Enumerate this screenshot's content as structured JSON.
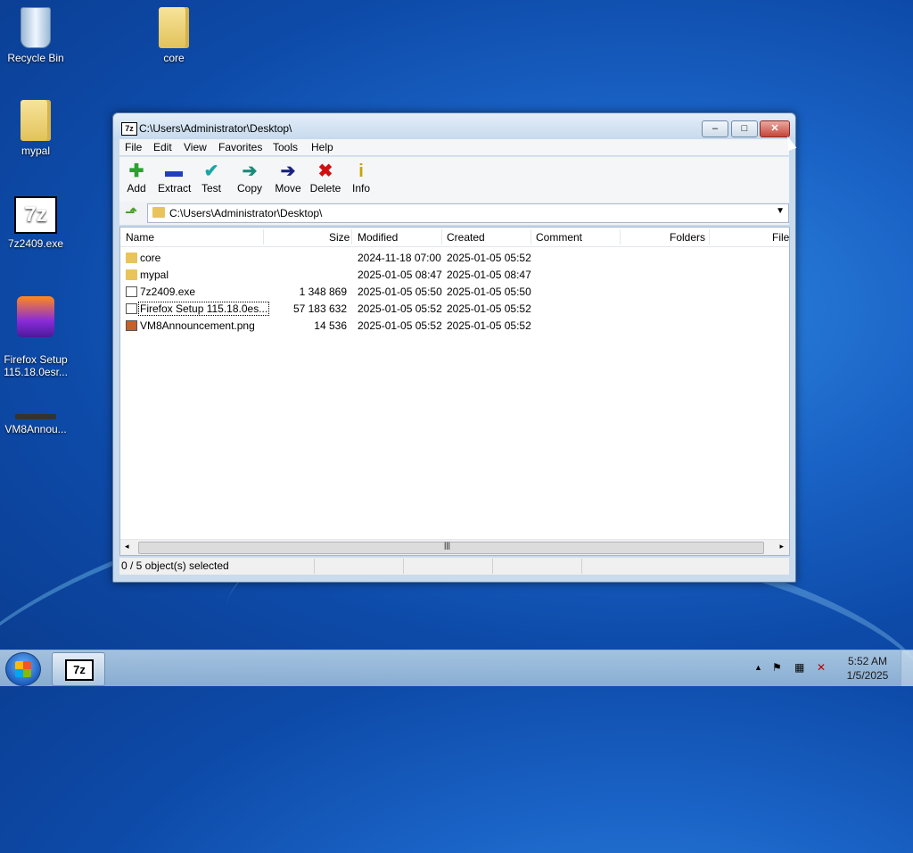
{
  "desktop": {
    "icons": [
      {
        "label": "Recycle Bin",
        "icon": "recycle-bin-icon"
      },
      {
        "label": "core",
        "icon": "folder-icon"
      },
      {
        "label": "mypal",
        "icon": "folder-icon"
      },
      {
        "label": "7z2409.exe",
        "icon": "7zip-icon"
      },
      {
        "label": "Firefox Setup\n115.18.0esr...",
        "icon": "firefox-icon"
      },
      {
        "label": "VM8Annou...",
        "icon": "image-file-icon"
      }
    ]
  },
  "window": {
    "title": "C:\\Users\\Administrator\\Desktop\\",
    "app_icon_text": "7z",
    "controls": {
      "minimize": "–",
      "maximize": "□",
      "close": "✕"
    }
  },
  "menu": [
    "File",
    "Edit",
    "View",
    "Favorites",
    "Tools",
    "Help"
  ],
  "toolbar": [
    {
      "label": "Add",
      "glyph": "✚",
      "color": "#2aa32a"
    },
    {
      "label": "Extract",
      "glyph": "▬",
      "color": "#1f3fbf"
    },
    {
      "label": "Test",
      "glyph": "✔",
      "color": "#1aa6a6"
    },
    {
      "label": "Copy",
      "glyph": "➔",
      "color": "#1c8a7a"
    },
    {
      "label": "Move",
      "glyph": "➔",
      "color": "#1a237e"
    },
    {
      "label": "Delete",
      "glyph": "✖",
      "color": "#d01010"
    },
    {
      "label": "Info",
      "glyph": "i",
      "color": "#c9a400"
    }
  ],
  "address": {
    "path": "C:\\Users\\Administrator\\Desktop\\"
  },
  "columns": [
    "Name",
    "Size",
    "Modified",
    "Created",
    "Comment",
    "Folders",
    "File"
  ],
  "files": [
    {
      "name": "core",
      "size": "",
      "modified": "2024-11-18 07:00",
      "created": "2025-01-05 05:52",
      "type": "folder"
    },
    {
      "name": "mypal",
      "size": "",
      "modified": "2025-01-05 08:47",
      "created": "2025-01-05 08:47",
      "type": "folder"
    },
    {
      "name": "7z2409.exe",
      "size": "1 348 869",
      "modified": "2025-01-05 05:50",
      "created": "2025-01-05 05:50",
      "type": "exe"
    },
    {
      "name": "Firefox Setup 115.18.0es...",
      "size": "57 183 632",
      "modified": "2025-01-05 05:52",
      "created": "2025-01-05 05:52",
      "type": "exe"
    },
    {
      "name": "VM8Announcement.png",
      "size": "14 536",
      "modified": "2025-01-05 05:52",
      "created": "2025-01-05 05:52",
      "type": "img"
    }
  ],
  "scroll_thumb_glyph": "|||",
  "status": "0 / 5 object(s) selected",
  "taskbar": {
    "task_label": "7z",
    "tray_up": "▲",
    "clock_time": "5:52 AM",
    "clock_date": "1/5/2025"
  }
}
